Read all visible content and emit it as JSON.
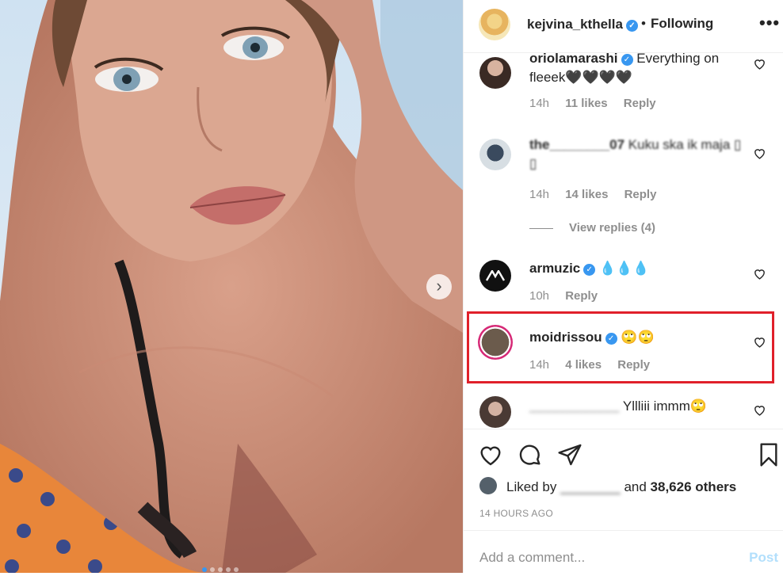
{
  "post": {
    "carousel": {
      "slide_count": 5,
      "active_index": 0
    }
  },
  "header": {
    "username": "kejvina_kthella",
    "separator": "•",
    "follow_status": "Following",
    "more_icon": "•••"
  },
  "comments": [
    {
      "username": "oriolamarashi",
      "verified": true,
      "text": "Everything on fleeek🖤🖤🖤🖤",
      "time": "14h",
      "likes": "11 likes",
      "reply": "Reply"
    },
    {
      "username": "the________07",
      "verified": false,
      "text": "Kuku ska ik maja ▯ ▯",
      "time": "14h",
      "likes": "14 likes",
      "reply": "Reply",
      "view_replies": "View replies (4)"
    },
    {
      "username": "armuzic",
      "verified": true,
      "text": "💧💧💧",
      "time": "10h",
      "likes": "",
      "reply": "Reply"
    },
    {
      "username": "moidrissou",
      "verified": true,
      "text": "🙄🙄",
      "time": "14h",
      "likes": "4 likes",
      "reply": "Reply"
    },
    {
      "username": "____________",
      "verified": false,
      "text": "Yllliii immm🙄",
      "time": "",
      "likes": "",
      "reply": ""
    }
  ],
  "actions": {
    "liked_prefix": "Liked by",
    "liked_name": "________",
    "liked_and": "and",
    "liked_others": "38,626 others",
    "timestamp": "14 HOURS AGO"
  },
  "add_comment": {
    "placeholder": "Add a comment...",
    "post_label": "Post"
  },
  "colors": {
    "accent": "#3897f0",
    "highlight": "#e0202a"
  }
}
